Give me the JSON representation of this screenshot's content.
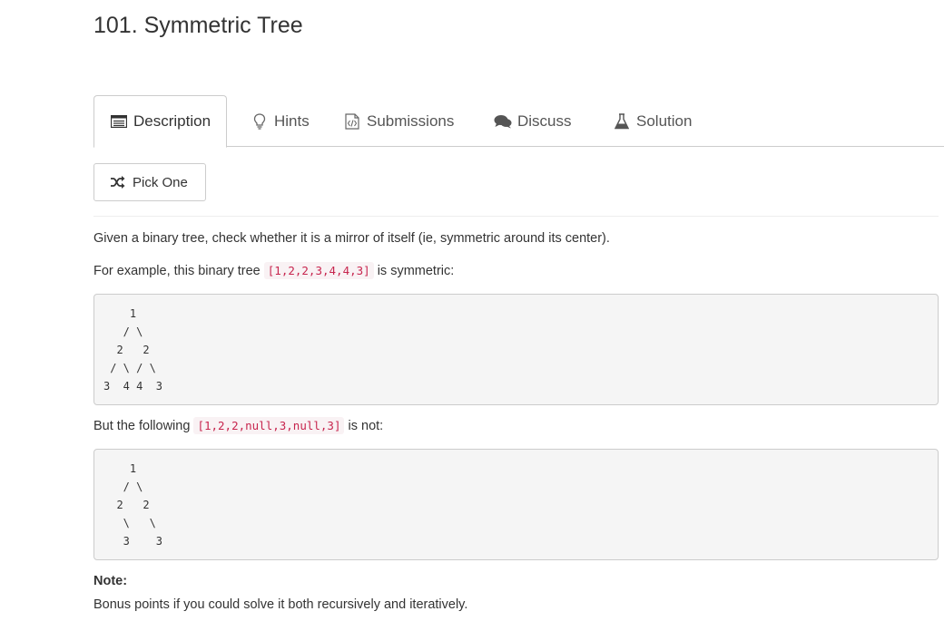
{
  "problem": {
    "title": "101. Symmetric Tree"
  },
  "tabs": [
    {
      "label": "Description",
      "icon": "list-icon",
      "active": true
    },
    {
      "label": "Hints",
      "icon": "lightbulb-icon",
      "active": false
    },
    {
      "label": "Submissions",
      "icon": "code-file-icon",
      "active": false
    },
    {
      "label": "Discuss",
      "icon": "comments-icon",
      "active": false
    },
    {
      "label": "Solution",
      "icon": "flask-icon",
      "active": false
    }
  ],
  "pick_one": {
    "label": "Pick One",
    "icon": "shuffle-icon"
  },
  "description": {
    "intro": "Given a binary tree, check whether it is a mirror of itself (ie, symmetric around its center).",
    "example_prefix": "For example, this binary tree ",
    "example_code": "[1,2,2,3,4,4,3]",
    "example_suffix": " is symmetric:",
    "tree1": "    1\n   / \\\n  2   2\n / \\ / \\\n3  4 4  3",
    "counter_prefix": "But the following ",
    "counter_code": "[1,2,2,null,3,null,3]",
    "counter_suffix": " is not:",
    "tree2": "    1\n   / \\\n  2   2\n   \\   \\\n   3    3",
    "note_label": "Note:",
    "note_text": "Bonus points if you could solve it both recursively and iteratively."
  },
  "colors": {
    "code_text": "#c7254e",
    "code_bg": "#f9f2f4",
    "pre_bg": "#f5f5f5",
    "border": "#cccccc"
  }
}
